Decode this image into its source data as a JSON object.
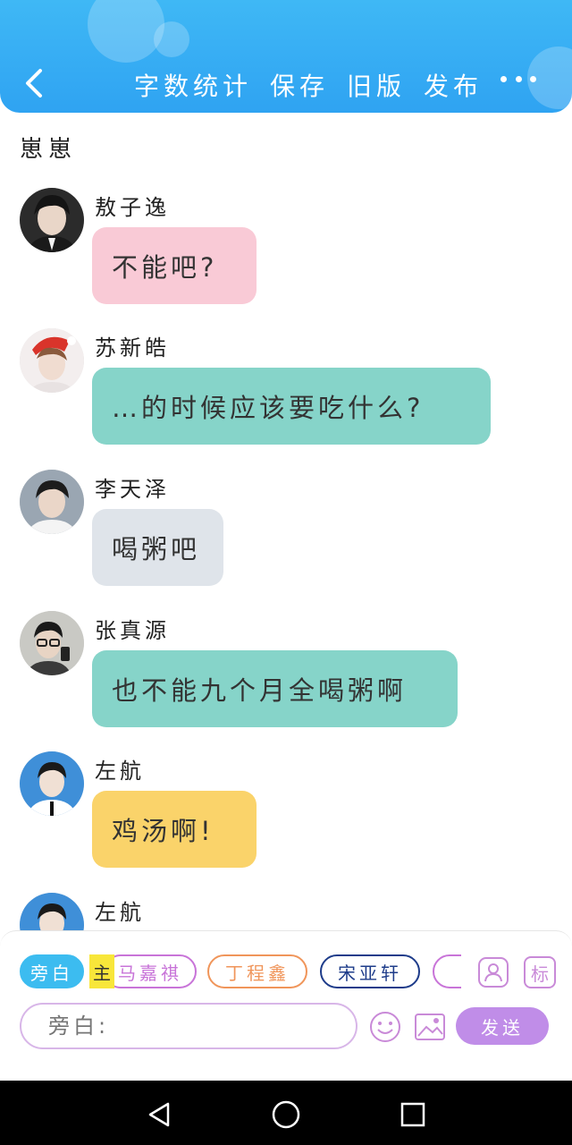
{
  "header": {
    "toolbar": [
      "字数统计",
      "保存",
      "旧版",
      "发布"
    ],
    "icons": {
      "back": "chevron-left-icon",
      "more": "more-dots-icon"
    }
  },
  "story": {
    "title": "崽崽"
  },
  "messages": [
    {
      "sender": "敖子逸",
      "text": "不能吧?",
      "bubble_color": "#f9cad6"
    },
    {
      "sender": "苏新皓",
      "text": "…的时候应该要吃什么?",
      "bubble_color": "#86d4c9"
    },
    {
      "sender": "李天泽",
      "text": "喝粥吧",
      "bubble_color": "#dfe4ea"
    },
    {
      "sender": "张真源",
      "text": "也不能九个月全喝粥啊",
      "bubble_color": "#86d4c9"
    },
    {
      "sender": "左航",
      "text": "鸡汤啊!",
      "bubble_color": "#fad36a"
    },
    {
      "sender": "左航",
      "text": ""
    }
  ],
  "composer": {
    "chips": [
      {
        "label": "旁白",
        "color": "#3cbcf0",
        "selected": true
      },
      {
        "label": "马嘉祺",
        "color": "#c874d8"
      },
      {
        "label": "丁程鑫",
        "color": "#f0955a"
      },
      {
        "label": "宋亚轩",
        "color": "#1e3c8a"
      },
      {
        "label": "",
        "color": "#c874d8"
      }
    ],
    "main_tag": "主",
    "tag_button": "标",
    "input_placeholder": "旁白:",
    "send_label": "发送",
    "icons": [
      "person-icon",
      "tag-icon",
      "emoji-icon",
      "image-icon"
    ]
  },
  "navbar": {
    "icons": [
      "back-triangle-icon",
      "home-circle-icon",
      "recents-square-icon"
    ]
  }
}
